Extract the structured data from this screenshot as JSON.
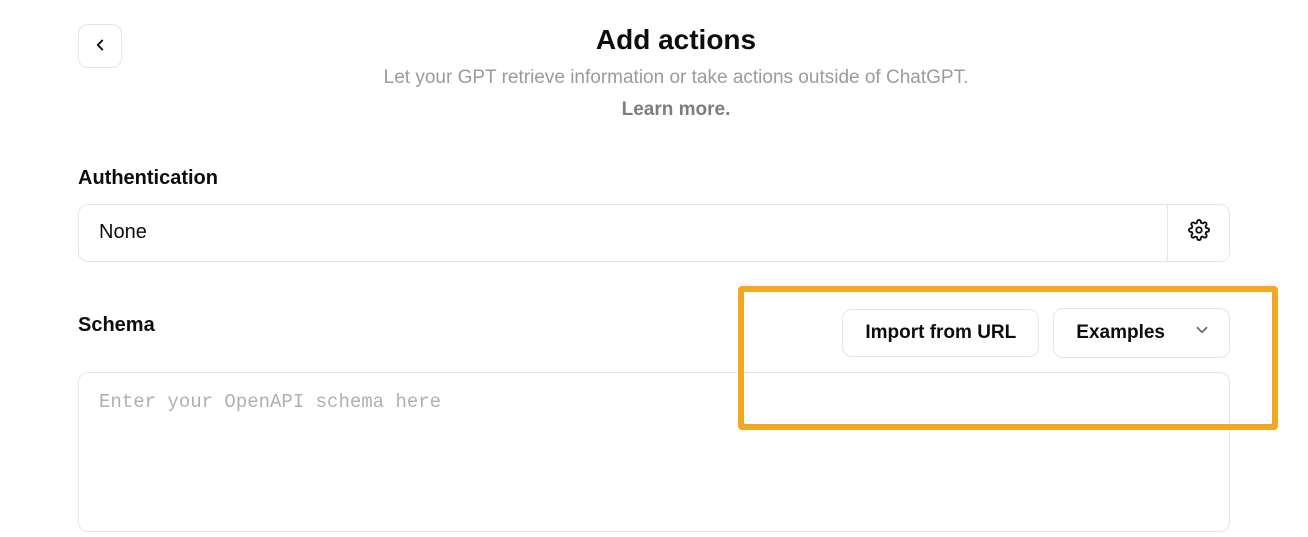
{
  "header": {
    "title": "Add actions",
    "subtitle": "Let your GPT retrieve information or take actions outside of ChatGPT.",
    "learn_more": "Learn more."
  },
  "authentication": {
    "label": "Authentication",
    "value": "None"
  },
  "schema": {
    "label": "Schema",
    "import_button": "Import from URL",
    "examples_button": "Examples",
    "placeholder": "Enter your OpenAPI schema here",
    "value": ""
  },
  "icons": {
    "back": "chevron-left",
    "settings": "gear",
    "dropdown": "chevron-down"
  }
}
